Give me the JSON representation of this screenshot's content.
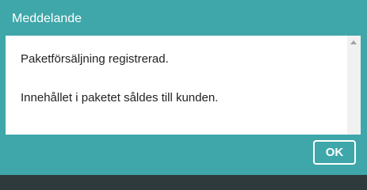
{
  "dialog": {
    "title": "Meddelande",
    "message_line1": "Paketförsäljning registrerad.",
    "message_line2": "Innehållet i paketet såldes till kunden.",
    "ok_label": "OK"
  },
  "background_icons": [
    "back-arrow-icon",
    "search-icon"
  ],
  "colors": {
    "accent": "#3fa6a9",
    "content_bg": "#ffffff",
    "text": "#222222"
  }
}
